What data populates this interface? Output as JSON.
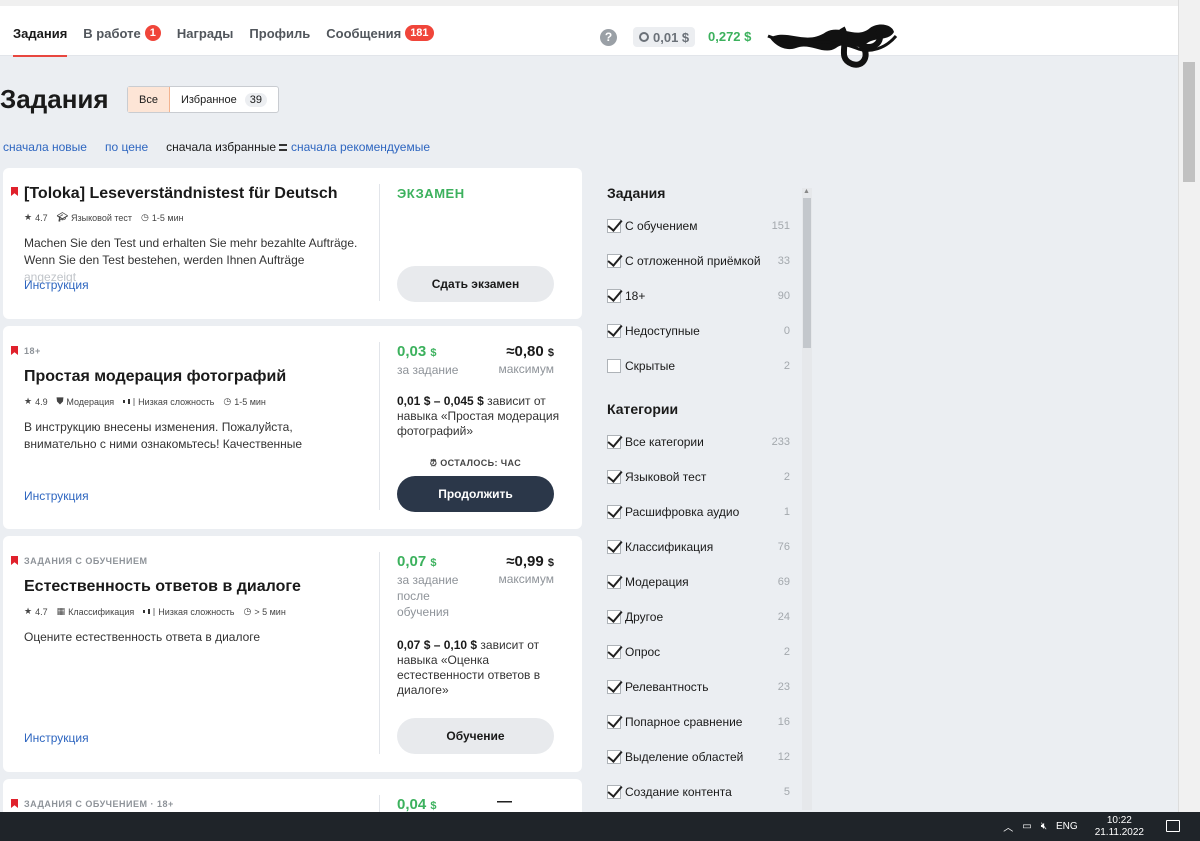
{
  "nav": {
    "items": [
      {
        "label": "Задания",
        "active": true
      },
      {
        "label": "В работе",
        "badge": "1"
      },
      {
        "label": "Награды"
      },
      {
        "label": "Профиль"
      },
      {
        "label": "Сообщения",
        "badge": "181"
      }
    ],
    "help": "?",
    "balance_pending": "0,01 $",
    "balance": "0,272 $"
  },
  "page": {
    "title": "Задания",
    "segments": [
      {
        "label": "Все",
        "active": true
      },
      {
        "label": "Избранное",
        "count": "39"
      }
    ],
    "sorts": {
      "newest": "сначала новые",
      "price": "по цене",
      "favorites": "сначала избранные",
      "recommended": "сначала рекомендуемые"
    }
  },
  "tasks": [
    {
      "pre": "",
      "title": "[Toloka] Leseverständnistest für Deutsch",
      "rating": "4.7",
      "type": "Языковой тест",
      "time": "1-5 мин",
      "desc": "Machen Sie den Test und erhalten Sie mehr bezahlte Aufträge. Wenn Sie den Test bestehen, werden Ihnen Aufträge ",
      "desc_fade": "angezeigt",
      "instruction": "Инструкция",
      "exam": "ЭКЗАМЕН",
      "button": "Сдать экзамен"
    },
    {
      "pre": "18+",
      "title": "Простая модерация фотографий",
      "rating": "4.9",
      "type": "Модерация",
      "difficulty": "Низкая сложность",
      "time": "1-5 мин",
      "desc": "В инструкцию внесены изменения. Пожалуйста, внимательно с ними ознакомьтесь! Качественные",
      "instruction": "Инструкция",
      "price": "0,03",
      "price_unit": "$",
      "price_label": "за задание",
      "max": "≈0,80",
      "max_unit": "$",
      "max_label": "максимум",
      "dep_range": "0,01 $ – 0,045 $",
      "dep_text": " зависит от навыка «Простая модерация фотографий»",
      "remain": "ОСТАЛОСЬ: ЧАС",
      "button": "Продолжить"
    },
    {
      "pre": "ЗАДАНИЯ С ОБУЧЕНИЕМ",
      "title": "Естественность ответов в диалоге",
      "rating": "4.7",
      "type": "Классификация",
      "difficulty": "Низкая сложность",
      "time": "> 5 мин",
      "desc": "Оцените естественность ответа в диалоге",
      "instruction": "Инструкция",
      "price": "0,07",
      "price_unit": "$",
      "price_label": "за задание после обучения",
      "max": "≈0,99",
      "max_unit": "$",
      "max_label": "максимум",
      "dep_range": "0,07 $ – 0,10 $",
      "dep_text": " зависит от навыка «Оценка естественности ответов в диалоге»",
      "button": "Обучение"
    },
    {
      "pre": "ЗАДАНИЯ С ОБУЧЕНИЕМ · 18+",
      "price": "0,04",
      "price_unit": "$",
      "max": "—"
    }
  ],
  "filters": {
    "tasks_title": "Задания",
    "tasks": [
      {
        "label": "С обучением",
        "count": "151",
        "checked": true
      },
      {
        "label": "С отложенной приёмкой",
        "count": "33",
        "checked": true
      },
      {
        "label": "18+",
        "count": "90",
        "checked": true
      },
      {
        "label": "Недоступные",
        "count": "0",
        "checked": true
      },
      {
        "label": "Скрытые",
        "count": "2",
        "checked": false
      }
    ],
    "categories_title": "Категории",
    "categories": [
      {
        "label": "Все категории",
        "count": "233",
        "checked": true
      },
      {
        "label": "Языковой тест",
        "count": "2",
        "checked": true
      },
      {
        "label": "Расшифровка аудио",
        "count": "1",
        "checked": true
      },
      {
        "label": "Классификация",
        "count": "76",
        "checked": true
      },
      {
        "label": "Модерация",
        "count": "69",
        "checked": true
      },
      {
        "label": "Другое",
        "count": "24",
        "checked": true
      },
      {
        "label": "Опрос",
        "count": "2",
        "checked": true
      },
      {
        "label": "Релевантность",
        "count": "23",
        "checked": true
      },
      {
        "label": "Попарное сравнение",
        "count": "16",
        "checked": true
      },
      {
        "label": "Выделение областей",
        "count": "12",
        "checked": true
      },
      {
        "label": "Создание контента",
        "count": "5",
        "checked": true
      }
    ]
  },
  "taskbar": {
    "lang": "ENG",
    "time": "10:22",
    "date": "21.11.2022"
  },
  "colors": {
    "accent_red": "#e8473f",
    "green": "#3cb15d",
    "link": "#2e66c0",
    "dark_button": "#2b3749"
  }
}
